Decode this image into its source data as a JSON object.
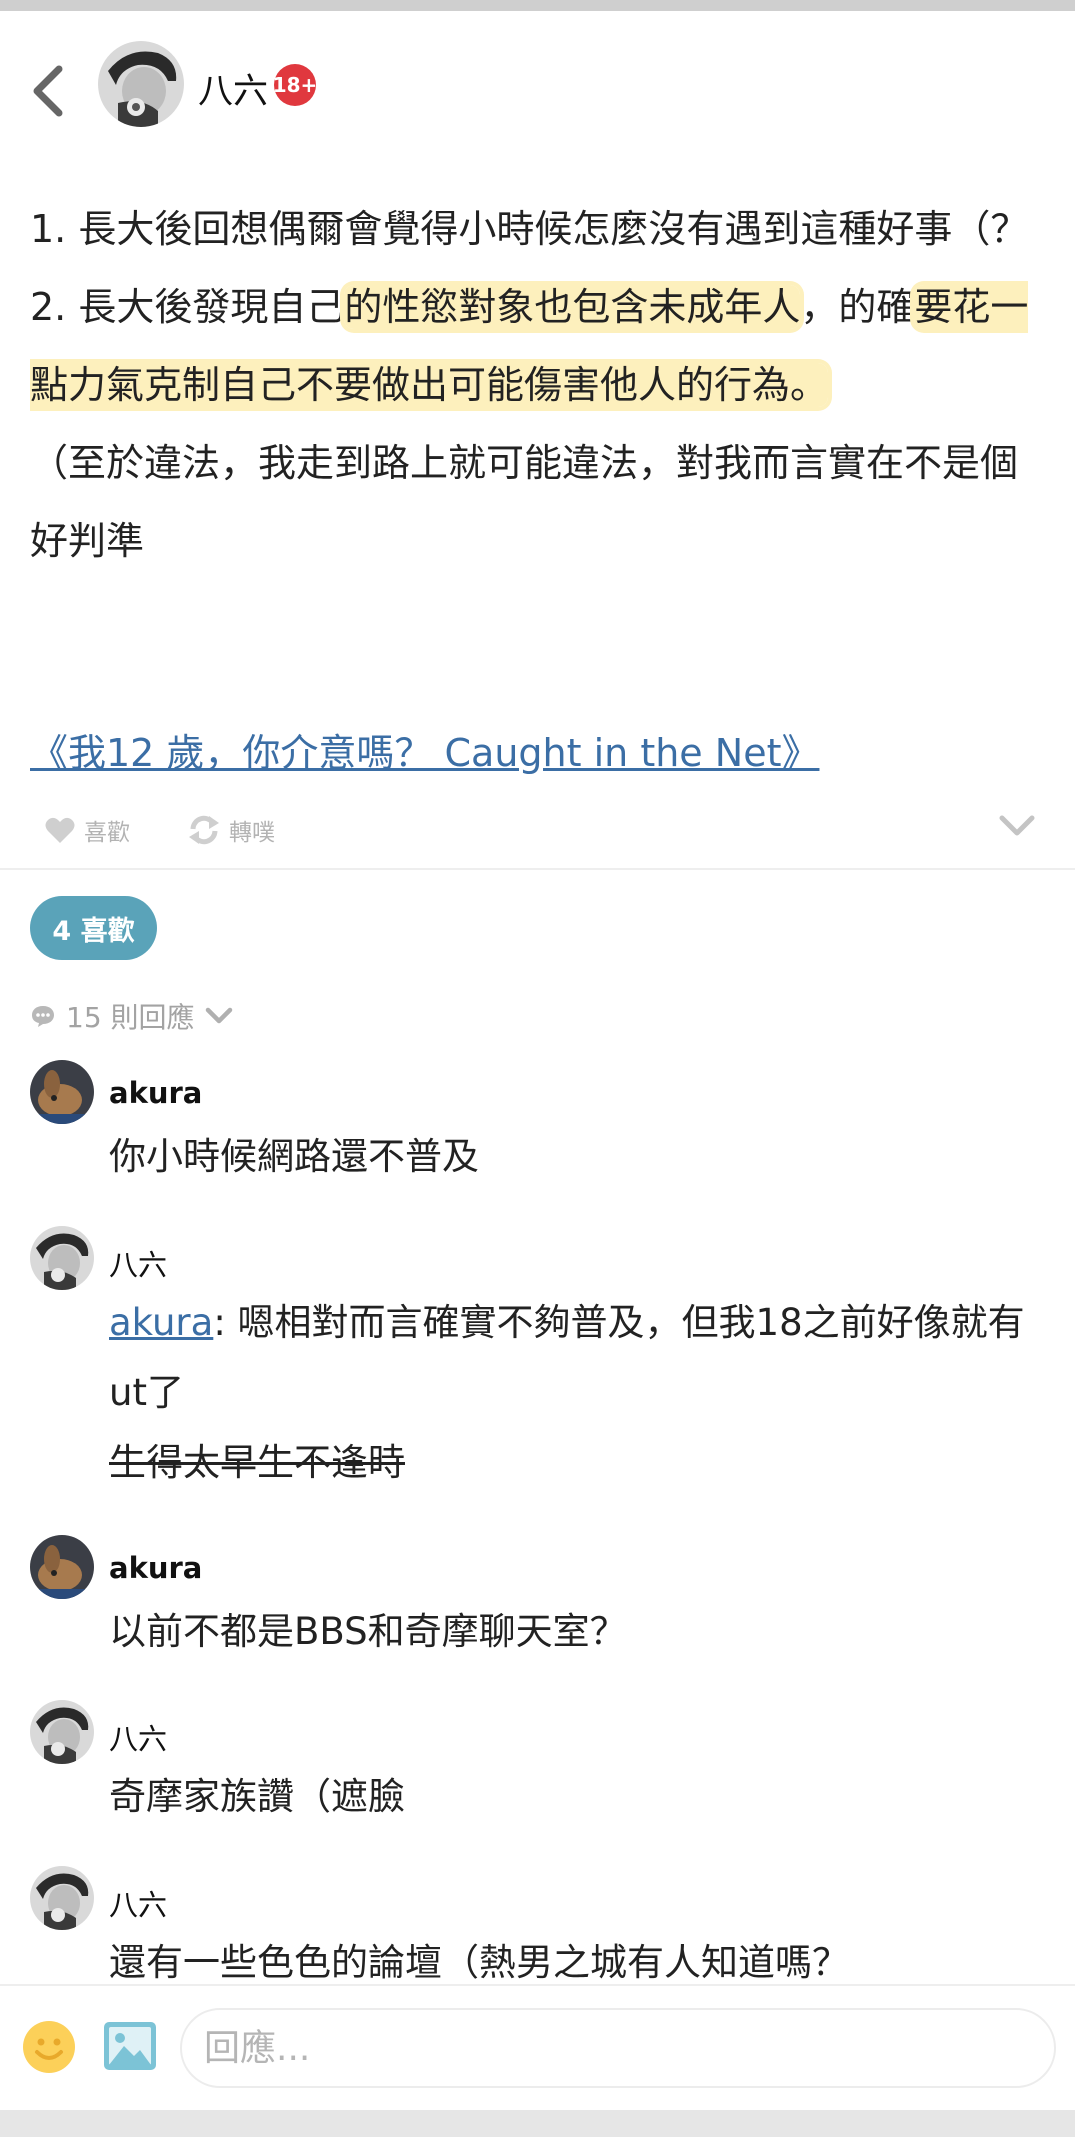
{
  "header": {
    "author_name": "八六",
    "age_badge": "18+"
  },
  "post": {
    "line1": "1. 長大後回想偶爾會覺得小時候怎麼沒有遇到這種好事（？",
    "line2_pre": "2. 長大後發現自己",
    "line2_hl1": "的性慾對象也包含未成年人",
    "line2_mid": "，的確",
    "line2_hl2": "要花一點力氣克制自己不要做出可能傷害他人的行為。",
    "line3": "（至於違法，我走到路上就可能違法，對我而言實在不是個好判準",
    "link_text": "《我12 歲，你介意嗎？ Caught in the Net》",
    "highlight_color": "#fdf0bd"
  },
  "actions": {
    "like_label": "喜歡",
    "replurk_label": "轉噗"
  },
  "likes": {
    "label": "4 喜歡",
    "color": "#5aa3b9"
  },
  "responses": {
    "count_label": "15 則回應"
  },
  "comments": [
    {
      "name": "akura",
      "text": "你小時候網路還不普及"
    },
    {
      "name": "八六",
      "mention": "akura",
      "text": ": 嗯相對而言確實不夠普及，但我18之前好像就有ut了",
      "strike_text": "生得太早生不逢時"
    },
    {
      "name": "akura",
      "text": "以前不都是BBS和奇摩聊天室？"
    },
    {
      "name": "八六",
      "text": "奇摩家族讚（遮臉"
    },
    {
      "name": "八六",
      "text": "還有一些色色的論壇（熱男之城有人知道嗎？"
    }
  ],
  "composer": {
    "placeholder": "回應..."
  },
  "colors": {
    "link": "#3b6ea5",
    "badge_red": "#e0383e",
    "muted": "#b3b3b3"
  },
  "icons": [
    "back-chevron-icon",
    "heart-icon",
    "replurk-icon",
    "chevron-down-icon",
    "speech-bubble-icon",
    "emoji-icon",
    "image-icon"
  ]
}
